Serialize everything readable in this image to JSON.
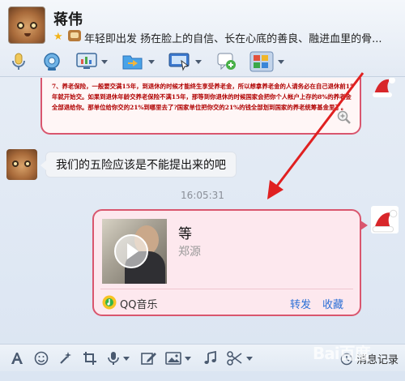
{
  "header": {
    "contact_name": "蒋伟",
    "signature": "年轻即出发 扬在脸上的自信、长在心底的善良、融进血里的骨..."
  },
  "toolbar": {
    "icons": [
      "microphone-icon",
      "video-call-icon",
      "screen-share-icon",
      "send-file-icon",
      "remote-desktop-icon",
      "add-chat-icon",
      "apps-icon"
    ]
  },
  "chat": {
    "previous_message": "7、养老保险，一般要交满15年，到退休的时候才能终生享受养老金，所以想拿养老金的人请务必在自己退休前15年就开始交。如果到退休年龄交养老保险不满15年，那等到你退休的时候国家会把你个人帐户上存的8%的养老金全部退给你。那单位给你交的21%到哪里去了?国家单位把你交的21%的钱全部划到国家的养老统筹基金里了。",
    "incoming_message": "我们的五险应该是不能提出来的吧",
    "timestamp": "16:05:31",
    "music_card": {
      "title": "等",
      "artist": "郑源",
      "source": "QQ音乐",
      "forward": "转发",
      "favorite": "收藏"
    }
  },
  "bottom_toolbar": {
    "history_label": "消息记录"
  },
  "watermark": "Bai百度",
  "colors": {
    "bubble_border": "#d9566e",
    "link": "#2b6fd6",
    "annotation_arrow": "#e02020"
  }
}
